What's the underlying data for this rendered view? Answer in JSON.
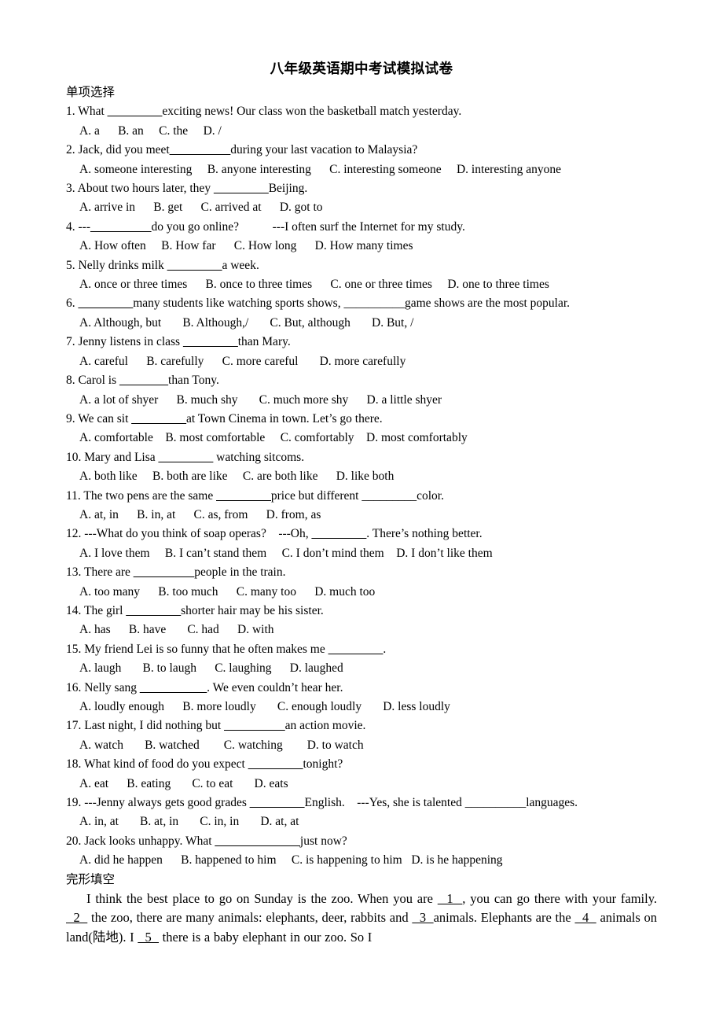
{
  "document": {
    "title": "八年级英语期中考试模拟试卷",
    "sections": [
      {
        "id": "multiple-choice",
        "heading": "单项选择"
      },
      {
        "id": "cloze",
        "heading": "完形填空"
      }
    ]
  },
  "questions": [
    {
      "stem_before": "1. What ",
      "blank": "_________",
      "stem_after": "exciting news! Our class won the basketball match yesterday.",
      "options": "A. a      B. an     C. the     D. /"
    },
    {
      "stem_before": "2. Jack, did you meet",
      "blank": "__________",
      "stem_after": "during your last vacation to Malaysia?",
      "options": "A. someone interesting     B. anyone interesting      C. interesting someone     D. interesting anyone"
    },
    {
      "stem_before": "3. About two hours later, they ",
      "blank": "_________",
      "stem_after": "Beijing.",
      "options": "A. arrive in      B. get      C. arrived at      D. got to"
    },
    {
      "stem_before": "4. ---",
      "blank": "__________",
      "stem_after": "do you go online?           ---I often surf the Internet for my study.",
      "options": "A. How often     B. How far      C. How long      D. How many times"
    },
    {
      "stem_before": "5. Nelly drinks milk ",
      "blank": "_________",
      "stem_after": "a week.",
      "options": "A. once or three times      B. once to three times      C. one or three times     D. one to three times"
    },
    {
      "stem_before": "6. ",
      "blank": "_________",
      "stem_after": "many students like watching sports shows, __________game shows are the most popular.",
      "options": "A. Although, but       B. Although,/       C. But, although       D. But, /"
    },
    {
      "stem_before": "7. Jenny listens in class ",
      "blank": "_________",
      "stem_after": "than Mary.",
      "options": "A. careful      B. carefully      C. more careful       D. more carefully"
    },
    {
      "stem_before": "8. Carol is ",
      "blank": "________",
      "stem_after": "than Tony.",
      "options": "A. a lot of shyer      B. much shy       C. much more shy      D. a little shyer"
    },
    {
      "stem_before": "9. We can sit ",
      "blank": "_________",
      "stem_after": "at Town Cinema in town. Let’s go there.",
      "options": "A. comfortable    B. most comfortable     C. comfortably    D. most comfortably"
    },
    {
      "stem_before": "10. Mary and Lisa ",
      "blank": "_________",
      "stem_after": " watching sitcoms.",
      "options": "A. both like     B. both are like     C. are both like      D. like both"
    },
    {
      "stem_before": "11. The two pens are the same ",
      "blank": "_________",
      "stem_after": "price but different _________color.",
      "options": "A. at, in      B. in, at      C. as, from      D. from, as"
    },
    {
      "stem_before": "12. ---What do you think of soap operas?    ---Oh, ",
      "blank": "_________",
      "stem_after": ". There’s nothing better.",
      "options": "A. I love them     B. I can’t stand them     C. I don’t mind them    D. I don’t like them"
    },
    {
      "stem_before": "13. There are ",
      "blank": "__________",
      "stem_after": "people in the train.",
      "options": "A. too many      B. too much      C. many too      D. much too"
    },
    {
      "stem_before": "14. The girl ",
      "blank": "_________",
      "stem_after": "shorter hair may be his sister.",
      "options": "A. has      B. have       C. had      D. with"
    },
    {
      "stem_before": "15. My friend Lei is so funny that he often makes me ",
      "blank": "_________",
      "stem_after": ".",
      "options": "A. laugh       B. to laugh      C. laughing      D. laughed"
    },
    {
      "stem_before": "16. Nelly sang ",
      "blank": "___________",
      "stem_after": ". We even couldn’t hear her.",
      "options": "A. loudly enough      B. more loudly       C. enough loudly       D. less loudly"
    },
    {
      "stem_before": "17. Last night, I did nothing but ",
      "blank": "__________",
      "stem_after": "an action movie.",
      "options": "A. watch       B. watched        C. watching        D. to watch"
    },
    {
      "stem_before": "18. What kind of food do you expect ",
      "blank": "_________",
      "stem_after": "tonight?",
      "options": "A. eat      B. eating       C. to eat       D. eats"
    },
    {
      "stem_before": "19. ---Jenny always gets good grades ",
      "blank": "_________",
      "stem_after": "English.    ---Yes, she is talented __________languages.",
      "options": "A. in, at       B. at, in       C. in, in       D. at, at"
    },
    {
      "stem_before": "20. Jack looks unhappy. What ",
      "blank": "______________",
      "stem_after": "just now?",
      "options": "A. did he happen      B. happened to him     C. is happening to him   D. is he happening"
    }
  ],
  "cloze_passage": {
    "segments": [
      {
        "type": "text",
        "value": "I think the best place to go on Sunday is the zoo. When you are "
      },
      {
        "type": "blank",
        "value": "  1  "
      },
      {
        "type": "text",
        "value": ", you can go there with your family. "
      },
      {
        "type": "blank",
        "value": "  2  "
      },
      {
        "type": "text",
        "value": " the zoo, there are many animals: elephants, deer, rabbits and "
      },
      {
        "type": "blank",
        "value": "  3  "
      },
      {
        "type": "text",
        "value": "animals. Elephants are the "
      },
      {
        "type": "blank",
        "value": "  4  "
      },
      {
        "type": "text",
        "value": " animals on land(陆地). I "
      },
      {
        "type": "blank",
        "value": "  5  "
      },
      {
        "type": "text",
        "value": " there is a baby elephant in our zoo. So I"
      }
    ]
  }
}
